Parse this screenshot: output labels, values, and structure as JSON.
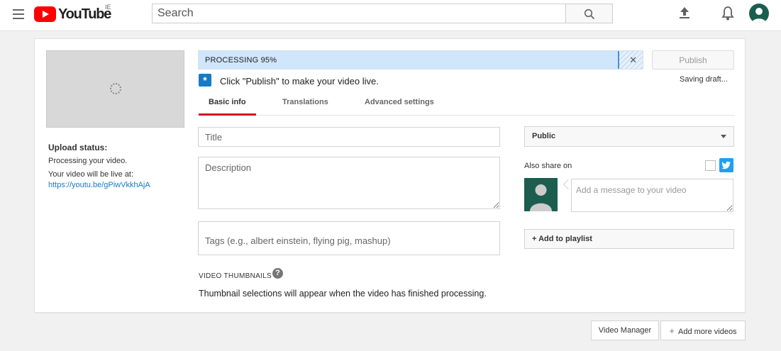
{
  "masthead": {
    "logo_text": "YouTube",
    "region": "IE",
    "search_placeholder": "Search"
  },
  "upload": {
    "status_label": "Upload status:",
    "processing_text": "Processing your video.",
    "live_at_text": "Your video will be live at:",
    "video_url": "https://youtu.be/gPiwVkkhAjA",
    "progress_text": "PROCESSING 95%",
    "progress_value": 0.95,
    "publish_label": "Publish",
    "saving_status": "Saving draft...",
    "publish_hint": "Click \"Publish\" to make your video live."
  },
  "tabs": [
    {
      "label": "Basic info",
      "active": true
    },
    {
      "label": "Translations",
      "active": false
    },
    {
      "label": "Advanced settings",
      "active": false
    }
  ],
  "form": {
    "title_placeholder": "Title",
    "description_placeholder": "Description",
    "tags_placeholder": "Tags (e.g., albert einstein, flying pig, mashup)",
    "thumbnails_label": "VIDEO THUMBNAILS",
    "thumbnails_note": "Thumbnail selections will appear when the video has finished processing."
  },
  "sidebar": {
    "privacy_value": "Public",
    "also_share_label": "Also share on",
    "message_placeholder": "Add a message to your video",
    "add_playlist_label": "+ Add to playlist"
  },
  "footer": {
    "video_manager_label": "Video Manager",
    "add_more_label": "Add more videos"
  },
  "colors": {
    "brand_red": "#ff0000",
    "accent_blue": "#167ac6",
    "tab_underline": "#cc181e",
    "twitter_blue": "#1da1f2",
    "avatar_green": "#1b5e50"
  }
}
